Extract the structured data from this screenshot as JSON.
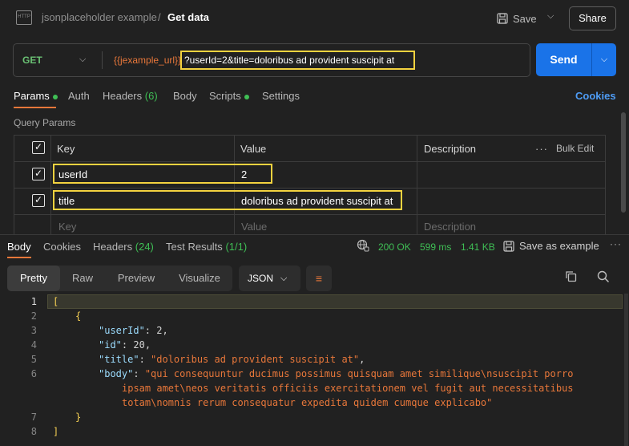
{
  "header": {
    "breadcrumb_collection": "jsonplaceholder example",
    "breadcrumb_sep": "/",
    "title": "Get data",
    "save_label": "Save",
    "share_label": "Share",
    "http_icon_text": "HTTP"
  },
  "request": {
    "method": "GET",
    "url_variable": "{{jexample_url}}",
    "url_query": "?userId=2&title=doloribus ad provident suscipit at",
    "send_label": "Send"
  },
  "req_tabs": {
    "params": "Params",
    "auth": "Auth",
    "headers": "Headers",
    "headers_count": "(6)",
    "body": "Body",
    "scripts": "Scripts",
    "settings": "Settings",
    "cookies": "Cookies"
  },
  "params": {
    "section_title": "Query Params",
    "columns": {
      "key": "Key",
      "value": "Value",
      "description": "Description",
      "bulk_edit": "Bulk Edit"
    },
    "rows": [
      {
        "key": "userId",
        "value": "2",
        "checked": true
      },
      {
        "key": "title",
        "value": "doloribus ad provident suscipit at",
        "checked": true
      }
    ],
    "placeholder": {
      "key": "Key",
      "value": "Value",
      "description": "Description"
    }
  },
  "response": {
    "tabs": {
      "body": "Body",
      "cookies": "Cookies",
      "headers": "Headers",
      "headers_count": "(24)",
      "test_results": "Test Results",
      "test_count": "(1/1)"
    },
    "status": "200 OK",
    "time": "599 ms",
    "size": "1.41 KB",
    "save_example": "Save as example",
    "format_tabs": {
      "pretty": "Pretty",
      "raw": "Raw",
      "preview": "Preview",
      "visualize": "Visualize"
    },
    "format_select": "JSON",
    "line_numbers": [
      "1",
      "2",
      "3",
      "4",
      "5",
      "6",
      "7",
      "8"
    ],
    "code": {
      "l1": "[",
      "l2": "{",
      "userId_key": "\"userId\"",
      "userId_val": "2",
      "id_key": "\"id\"",
      "id_val": "20",
      "title_key": "\"title\"",
      "title_val": "\"doloribus ad provident suscipit at\"",
      "body_key": "\"body\"",
      "body_val_1": "\"qui consequuntur ducimus possimus quisquam amet similique\\nsuscipit porro",
      "body_val_2": "ipsam amet\\neos veritatis officiis exercitationem vel fugit aut necessitatibus",
      "body_val_3": "totam\\nomnis rerum consequatur expedita quidem cumque explicabo\"",
      "l7": "}",
      "l8": "]"
    }
  },
  "colors": {
    "accent_orange": "#e8773a",
    "send_blue": "#1a73e8",
    "success_green": "#3fbf55",
    "highlight_yellow": "#f3d23f"
  }
}
